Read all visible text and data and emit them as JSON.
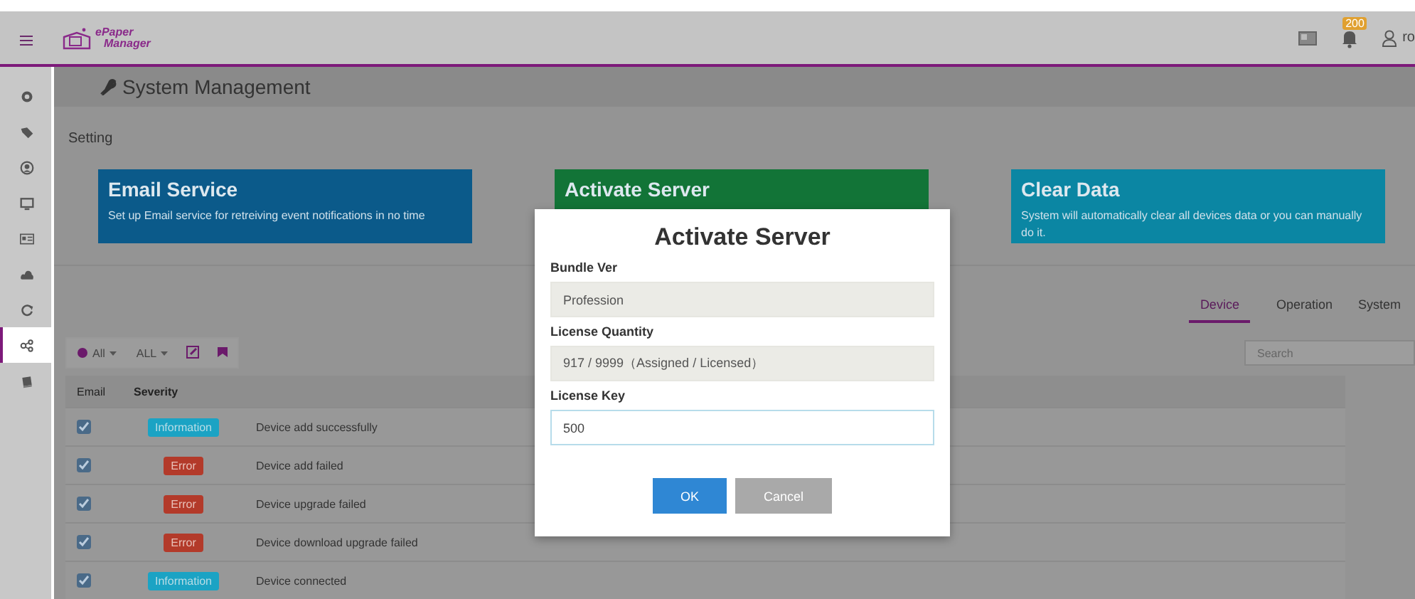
{
  "header": {
    "logo_top": "ePaper",
    "logo_bottom": "Manager",
    "notification_count": "200",
    "user": "ro"
  },
  "sidebar": {
    "items": [
      {
        "selected": false
      },
      {
        "selected": false
      },
      {
        "selected": false
      },
      {
        "selected": false
      },
      {
        "selected": false
      },
      {
        "selected": false
      },
      {
        "selected": false
      },
      {
        "selected": true
      },
      {
        "selected": false
      }
    ]
  },
  "page": {
    "title": "System Management",
    "section": "Setting"
  },
  "cards": [
    {
      "title": "Email Service",
      "text": "Set up Email service for retreiving event notifications in no time",
      "color": "#0b5a8a"
    },
    {
      "title": "Activate Server",
      "color": "#127437"
    },
    {
      "title": "Clear Data",
      "text": "System will automatically clear all devices data or you can manually do it.",
      "color": "#0b86a3"
    }
  ],
  "tabs": [
    {
      "label": "Device",
      "selected": true
    },
    {
      "label": "Operation",
      "selected": false
    },
    {
      "label": "System",
      "selected": false
    }
  ],
  "search": {
    "placeholder": "Search"
  },
  "toolbar": {
    "filter_1": "All",
    "filter_2": "ALL"
  },
  "table": {
    "columns": [
      "Email",
      "Severity"
    ],
    "rows": [
      {
        "checked": true,
        "severity": "Information",
        "kind": "info",
        "description": "Device add successfully"
      },
      {
        "checked": true,
        "severity": "Error",
        "kind": "error",
        "description": "Device add failed"
      },
      {
        "checked": true,
        "severity": "Error",
        "kind": "error",
        "description": "Device upgrade failed"
      },
      {
        "checked": true,
        "severity": "Error",
        "kind": "error",
        "description": "Device download upgrade failed"
      },
      {
        "checked": true,
        "severity": "Information",
        "kind": "info",
        "description": "Device connected"
      }
    ]
  },
  "dialog": {
    "title": "Activate Server",
    "fields": [
      {
        "label": "Bundle Ver",
        "value": "Profession",
        "disabled": true
      },
      {
        "label": "License Quantity",
        "value": "917 / 9999（Assigned / Licensed）",
        "disabled": true
      },
      {
        "label": "License Key",
        "value": "500",
        "disabled": false
      }
    ],
    "buttons": [
      {
        "label": "OK",
        "kind": "primary"
      },
      {
        "label": "Cancel",
        "kind": "secondary"
      }
    ]
  }
}
